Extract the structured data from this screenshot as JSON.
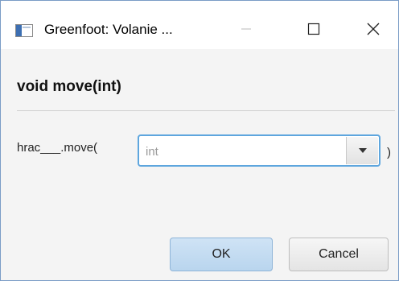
{
  "window": {
    "title": "Greenfoot:  Volanie ...",
    "icon": "app-window-icon",
    "controls": [
      "minimize-icon",
      "maximize-icon",
      "close-icon"
    ]
  },
  "dialog": {
    "signature": "void move(int)",
    "call_prefix": "hrac___.move(",
    "call_suffix": ")",
    "argument": {
      "value": "",
      "placeholder": "int"
    },
    "buttons": {
      "ok_label": "OK",
      "cancel_label": "Cancel"
    }
  },
  "colors": {
    "focus_border": "#5ea6de",
    "default_button": "#c4dcf2"
  }
}
